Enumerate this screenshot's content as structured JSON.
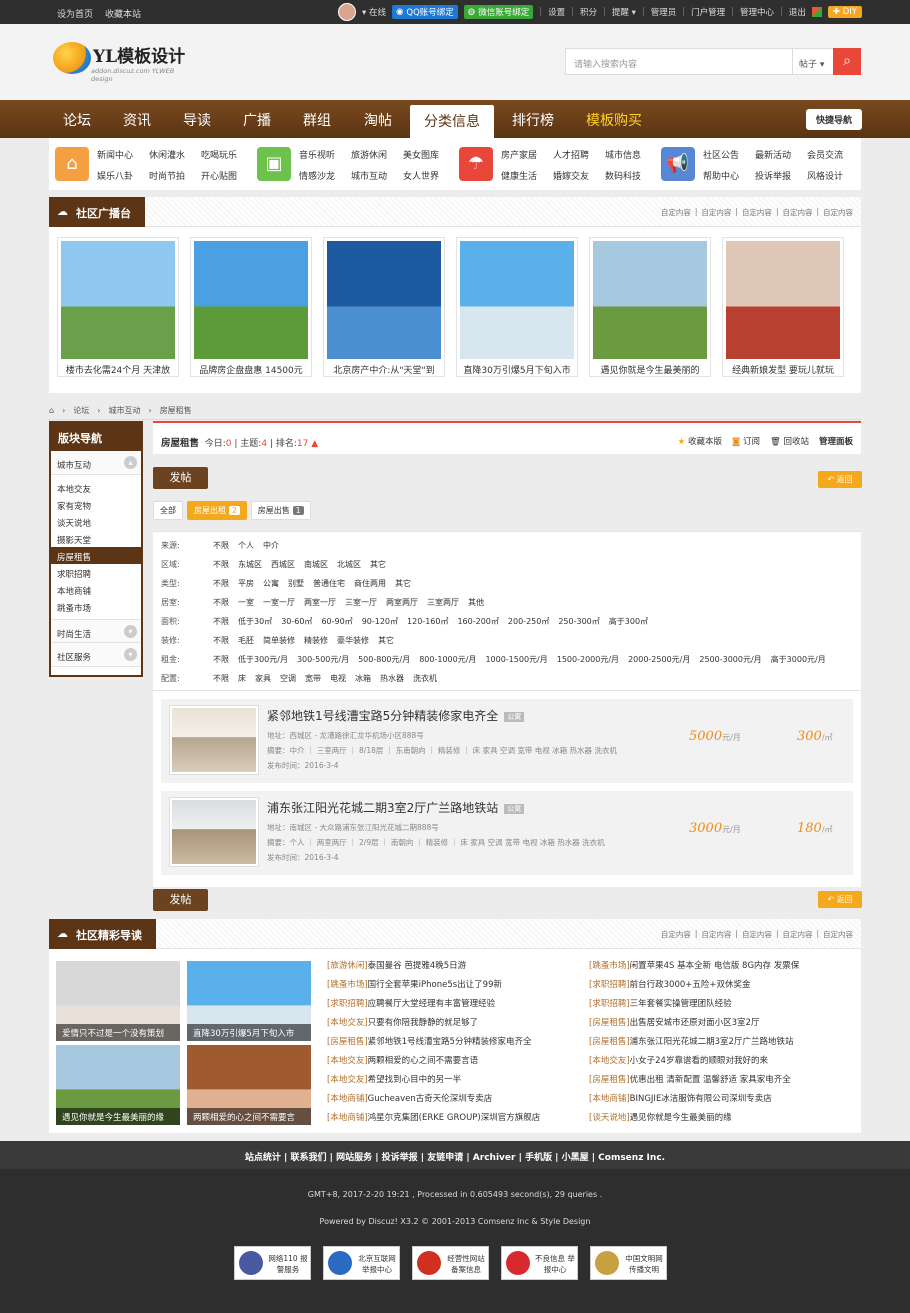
{
  "topbar": {
    "left_links": [
      "设为首页",
      "收藏本站"
    ],
    "online": "在线",
    "qq_bind": "QQ账号绑定",
    "wx_bind": "微信账号绑定",
    "right_links": [
      "设置",
      "积分",
      "提醒",
      "管理员",
      "门户管理",
      "管理中心",
      "退出"
    ],
    "diy": "DIY"
  },
  "header": {
    "logo_text": "YL模板设计",
    "logo_sub": "addon.discuz.com YLWEB design",
    "search_placeholder": "请输入搜索内容",
    "search_type": "帖子"
  },
  "nav": {
    "items": [
      "论坛",
      "资讯",
      "导读",
      "广播",
      "群组",
      "淘帖",
      "分类信息",
      "排行榜",
      "模板购买"
    ],
    "active": "分类信息",
    "highlight": "模板购买",
    "quick": "快捷导航"
  },
  "subnav": [
    {
      "icon": "home-icon",
      "color": "#f4a040",
      "links": [
        "新闻中心",
        "休闲灌水",
        "吃喝玩乐",
        "娱乐八卦",
        "时尚节拍",
        "开心贴图"
      ]
    },
    {
      "icon": "image-icon",
      "color": "#6cc24a",
      "links": [
        "音乐视听",
        "旅游休闲",
        "美女图库",
        "情感沙龙",
        "城市互动",
        "女人世界"
      ]
    },
    {
      "icon": "umbrella-icon",
      "color": "#e9473a",
      "links": [
        "房产家居",
        "人才招聘",
        "城市信息",
        "健康生活",
        "婚嫁交友",
        "数码科技"
      ]
    },
    {
      "icon": "megaphone-icon",
      "color": "#5a86d6",
      "links": [
        "社区公告",
        "最新活动",
        "会员交流",
        "帮助中心",
        "投诉举报",
        "风格设计"
      ]
    }
  ],
  "broadcast": {
    "title": "社区广播台",
    "more": [
      "自定内容",
      "自定内容",
      "自定内容",
      "自定内容",
      "自定内容"
    ],
    "items": [
      {
        "caption": "楼市去化需24个月 天津放",
        "palette": [
          "#8fc8ee",
          "#6aa04a"
        ]
      },
      {
        "caption": "品牌房企盘盘惠 14500元",
        "palette": [
          "#4aa0e0",
          "#5c9a3a"
        ]
      },
      {
        "caption": "北京房产中介:从\"天堂\"到",
        "palette": [
          "#1e5aa0",
          "#4a90d0"
        ]
      },
      {
        "caption": "直降30万引爆5月下旬入市",
        "palette": [
          "#5ab0ea",
          "#d8e6f0"
        ]
      },
      {
        "caption": "遇见你就是今生最美丽的",
        "palette": [
          "#a6c9e0",
          "#6b9a40"
        ]
      },
      {
        "caption": "经典新娘发型 要玩儿就玩",
        "palette": [
          "#e0c8b8",
          "#b84030"
        ]
      }
    ]
  },
  "breadcrumb": [
    "论坛",
    "城市互动",
    "房屋租售"
  ],
  "sidebar": {
    "title": "版块导航",
    "groups": [
      {
        "label": "城市互动",
        "items": [
          "本地交友",
          "家有宠物",
          "谈天说地",
          "摄影天堂",
          "房屋租售",
          "求职招聘",
          "本地商铺",
          "跳蚤市场"
        ]
      },
      {
        "label": "时尚生活",
        "items": []
      },
      {
        "label": "社区服务",
        "items": []
      }
    ],
    "active": "房屋租售"
  },
  "forum": {
    "name": "房屋租售",
    "today_label": "今日:",
    "today": "0",
    "topics_label": "主题:",
    "topics": "4",
    "rank_label": "排名:",
    "rank": "17",
    "ops": [
      "收藏本版",
      "订阅",
      "回收站",
      "管理面板"
    ],
    "post_btn": "发帖",
    "back_btn": "返回",
    "tabs": [
      {
        "label": "全部",
        "count": ""
      },
      {
        "label": "房屋出租",
        "count": "2"
      },
      {
        "label": "房屋出售",
        "count": "1"
      }
    ]
  },
  "filters": [
    {
      "label": "来源:",
      "opts": [
        "不限",
        "个人",
        "中介"
      ]
    },
    {
      "label": "区域:",
      "opts": [
        "不限",
        "东城区",
        "西城区",
        "南城区",
        "北城区",
        "其它"
      ]
    },
    {
      "label": "类型:",
      "opts": [
        "不限",
        "平房",
        "公寓",
        "别墅",
        "普通住宅",
        "商住两用",
        "其它"
      ]
    },
    {
      "label": "居室:",
      "opts": [
        "不限",
        "一室",
        "一室一厅",
        "两室一厅",
        "三室一厅",
        "两室两厅",
        "三室两厅",
        "其他"
      ]
    },
    {
      "label": "面积:",
      "opts": [
        "不限",
        "低于30㎡",
        "30-60㎡",
        "60-90㎡",
        "90-120㎡",
        "120-160㎡",
        "160-200㎡",
        "200-250㎡",
        "250-300㎡",
        "高于300㎡"
      ]
    },
    {
      "label": "装修:",
      "opts": [
        "不限",
        "毛胚",
        "简单装修",
        "精装修",
        "豪华装修",
        "其它"
      ]
    },
    {
      "label": "租金:",
      "opts": [
        "不限",
        "低于300元/月",
        "300-500元/月",
        "500-800元/月",
        "800-1000元/月",
        "1000-1500元/月",
        "1500-2000元/月",
        "2000-2500元/月",
        "2500-3000元/月",
        "高于3000元/月"
      ]
    },
    {
      "label": "配置:",
      "opts": [
        "不限",
        "床",
        "家具",
        "空调",
        "宽带",
        "电视",
        "冰箱",
        "热水器",
        "洗衣机"
      ]
    }
  ],
  "listings": [
    {
      "title": "紧邻地铁1号线漕宝路5分钟精装修家电齐全",
      "badge": "公寓",
      "address": "地址：西城区 - 龙漕路徐汇龙华机场小区888号",
      "summary": "摘要：中介 ｜ 三室两厅 ｜ 8/18层 ｜ 东南朝向 ｜ 精装修 ｜ 床 家具 空调 宽带 电视 冰箱 热水器 洗衣机",
      "time": "发布时间：2016-3-4",
      "price": "5000",
      "price_unit": "元/月",
      "area": "300",
      "area_unit": "/㎡"
    },
    {
      "title": "浦东张江阳光花城二期3室2厅广兰路地铁站",
      "badge": "公寓",
      "address": "地址：南城区 - 大众路浦东张江阳光花城二期888号",
      "summary": "摘要：个人 ｜ 两室两厅 ｜ 2/9层 ｜ 南朝向 ｜ 精装修 ｜ 床 家具 空调 宽带 电视 冰箱 热水器 洗衣机",
      "time": "发布时间：2016-3-4",
      "price": "3000",
      "price_unit": "元/月",
      "area": "180",
      "area_unit": "/㎡"
    }
  ],
  "guide": {
    "title": "社区精彩导读",
    "more": [
      "自定内容",
      "自定内容",
      "自定内容",
      "自定内容",
      "自定内容"
    ],
    "pics": [
      {
        "caption": "爱情只不过是一个没有策划",
        "palette": [
          "#d8d8d8",
          "#e8e0d8"
        ]
      },
      {
        "caption": "直降30万引爆5月下旬入市",
        "palette": [
          "#5ab0ea",
          "#d8e6f0"
        ]
      },
      {
        "caption": "遇见你就是今生最美丽的缘",
        "palette": [
          "#a6c9e0",
          "#6b9a40"
        ]
      },
      {
        "caption": "两颗相爱的心之间不需要言",
        "palette": [
          "#a05a30",
          "#e0b090"
        ]
      }
    ],
    "col1": [
      {
        "cat": "[旅游休闲]",
        "text": "泰国曼谷 芭提雅4晚5日游"
      },
      {
        "cat": "[跳蚤市场]",
        "text": "国行全套苹果iPhone5s出让了99新"
      },
      {
        "cat": "[求职招聘]",
        "text": "应聘餐厅大堂经理有丰富管理经验"
      },
      {
        "cat": "[本地交友]",
        "text": "只要有你陪我静静的就足够了"
      },
      {
        "cat": "[房屋租售]",
        "text": "紧邻地铁1号线漕宝路5分钟精装修家电齐全"
      },
      {
        "cat": "[本地交友]",
        "text": "两颗相爱的心之间不需要言语"
      },
      {
        "cat": "[本地交友]",
        "text": "希望找到心目中的另一半"
      },
      {
        "cat": "[本地商铺]",
        "text": "Gucheaven古奇天伦深圳专卖店"
      },
      {
        "cat": "[本地商铺]",
        "text": "鸿星尔克集团(ERKE GROUP)深圳官方旗舰店"
      }
    ],
    "col2": [
      {
        "cat": "[跳蚤市场]",
        "text": "闲置苹果4S 基本全新 电信版 8G内存 发票保"
      },
      {
        "cat": "[求职招聘]",
        "text": "前台行政3000+五险+双休奖金"
      },
      {
        "cat": "[求职招聘]",
        "text": "三年套餐实操管理团队经验"
      },
      {
        "cat": "[房屋租售]",
        "text": "出售居安城市还原对面小区3室2厅"
      },
      {
        "cat": "[房屋租售]",
        "text": "浦东张江阳光花城二期3室2厅广兰路地铁站"
      },
      {
        "cat": "[本地交友]",
        "text": "小女子24岁靠谱看的顺眼对我好的来"
      },
      {
        "cat": "[房屋租售]",
        "text": "优惠出租 清新配置 温馨舒适 家具家电齐全"
      },
      {
        "cat": "[本地商铺]",
        "text": "BINGJIE冰洁服饰有限公司深圳专卖店"
      },
      {
        "cat": "[谈天说地]",
        "text": "遇见你就是今生最美丽的缘"
      }
    ]
  },
  "footer": {
    "links": [
      "站点统计",
      "联系我们",
      "网站服务",
      "投诉举报",
      "友链申请",
      "Archiver",
      "手机版",
      "小黑屋",
      "Comsenz Inc."
    ],
    "stats": "GMT+8, 2017-2-20 19:21 , Processed in 0.605493 second(s), 29 queries .",
    "powered": "Powered by Discuz! X3.2 © 2001-2013 Comsenz Inc & Style Design",
    "badges": [
      {
        "text": "网络110 报警服务",
        "color": "#4a5aa0"
      },
      {
        "text": "北京互联网 举报中心",
        "color": "#2a6ac0"
      },
      {
        "text": "经营性网站 备案信息",
        "color": "#d03020"
      },
      {
        "text": "不良信息 举报中心",
        "color": "#d82830"
      },
      {
        "text": "中国文明网 传播文明",
        "color": "#c8a040"
      }
    ]
  }
}
